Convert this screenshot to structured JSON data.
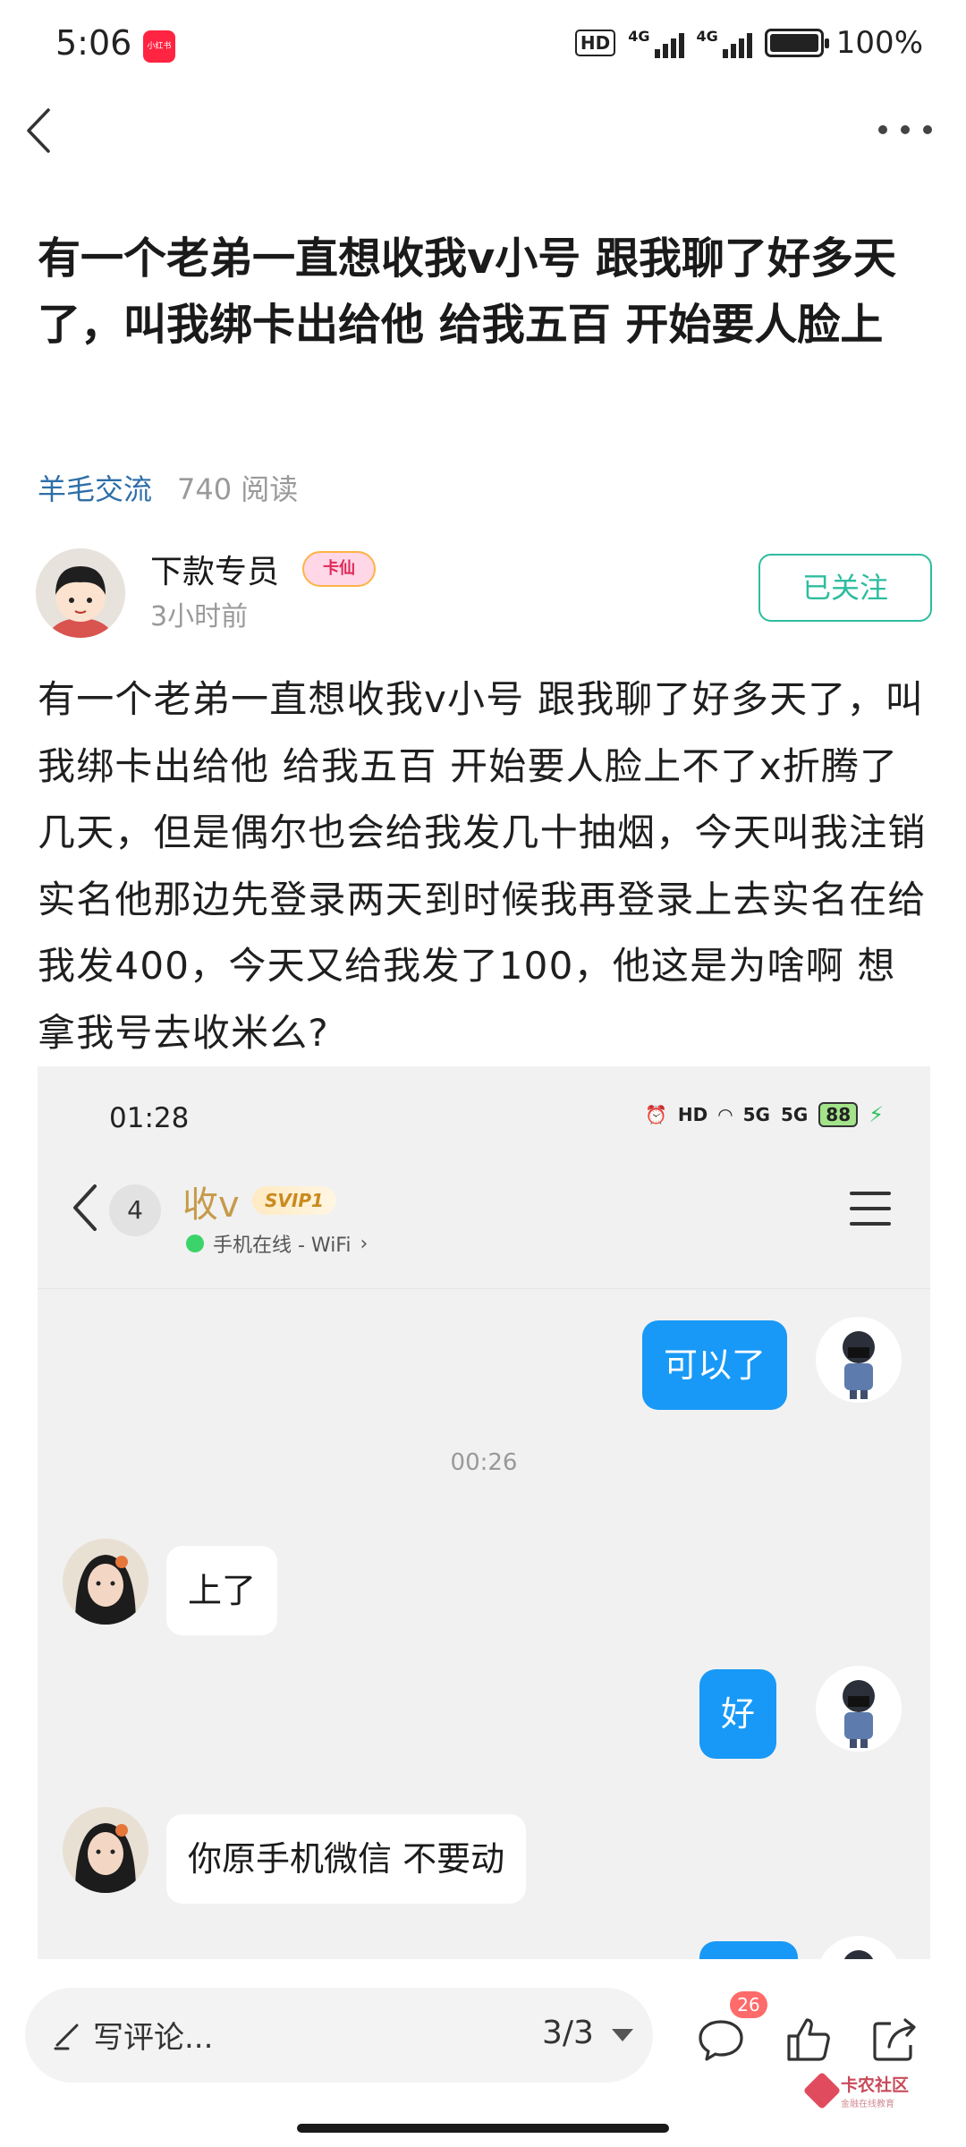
{
  "status_bar": {
    "time": "5:06",
    "app_badge": "小红书",
    "hd": "HD",
    "net1": "4G",
    "net2": "4G",
    "battery": "100%"
  },
  "post": {
    "title": "有一个老弟一直想收我v小号 跟我聊了好多天了，叫我绑卡出给他 给我五百 开始要人脸上",
    "category": "羊毛交流",
    "reads": "740 阅读",
    "author": {
      "name": "下款专员",
      "badge": "卡仙",
      "time": "3小时前",
      "follow_label": "已关注"
    },
    "body": "有一个老弟一直想收我v小号 跟我聊了好多天了，叫我绑卡出给他 给我五百 开始要人脸上不了x折腾了几天，但是偶尔也会给我发几十抽烟，今天叫我注销实名他那边先登录两天到时候我再登录上去实名在给我发400，今天又给我发了100，他这是为啥啊 想拿我号去收米么?"
  },
  "screenshot": {
    "time": "01:28",
    "hd": "HD",
    "net1": "5G",
    "net2": "5G",
    "battery": "88",
    "unread_count": "4",
    "contact_name": "收v",
    "svip": "SVIP1",
    "online_status": "手机在线 - WiFi",
    "messages": [
      {
        "side": "out",
        "text": "可以了"
      },
      {
        "side": "time",
        "text": "00:26"
      },
      {
        "side": "in",
        "text": "上了"
      },
      {
        "side": "out",
        "text": "好"
      },
      {
        "side": "in",
        "text": "你原手机微信  不要动"
      }
    ]
  },
  "bottom_bar": {
    "comment_placeholder": "写评论...",
    "pager": "3/3",
    "comment_count": "26",
    "watermark": "卡农社区",
    "watermark_sub": "金融在线教育"
  },
  "colors": {
    "accent": "#2ebc9f",
    "category_blue": "#2e6ea8",
    "bubble_out": "#1899f7",
    "badge_red": "#ff6a6a"
  },
  "icons": [
    "back-icon",
    "more-icon",
    "pen-icon",
    "caret-down-icon",
    "comment-icon",
    "like-icon",
    "share-icon",
    "menu-icon"
  ]
}
